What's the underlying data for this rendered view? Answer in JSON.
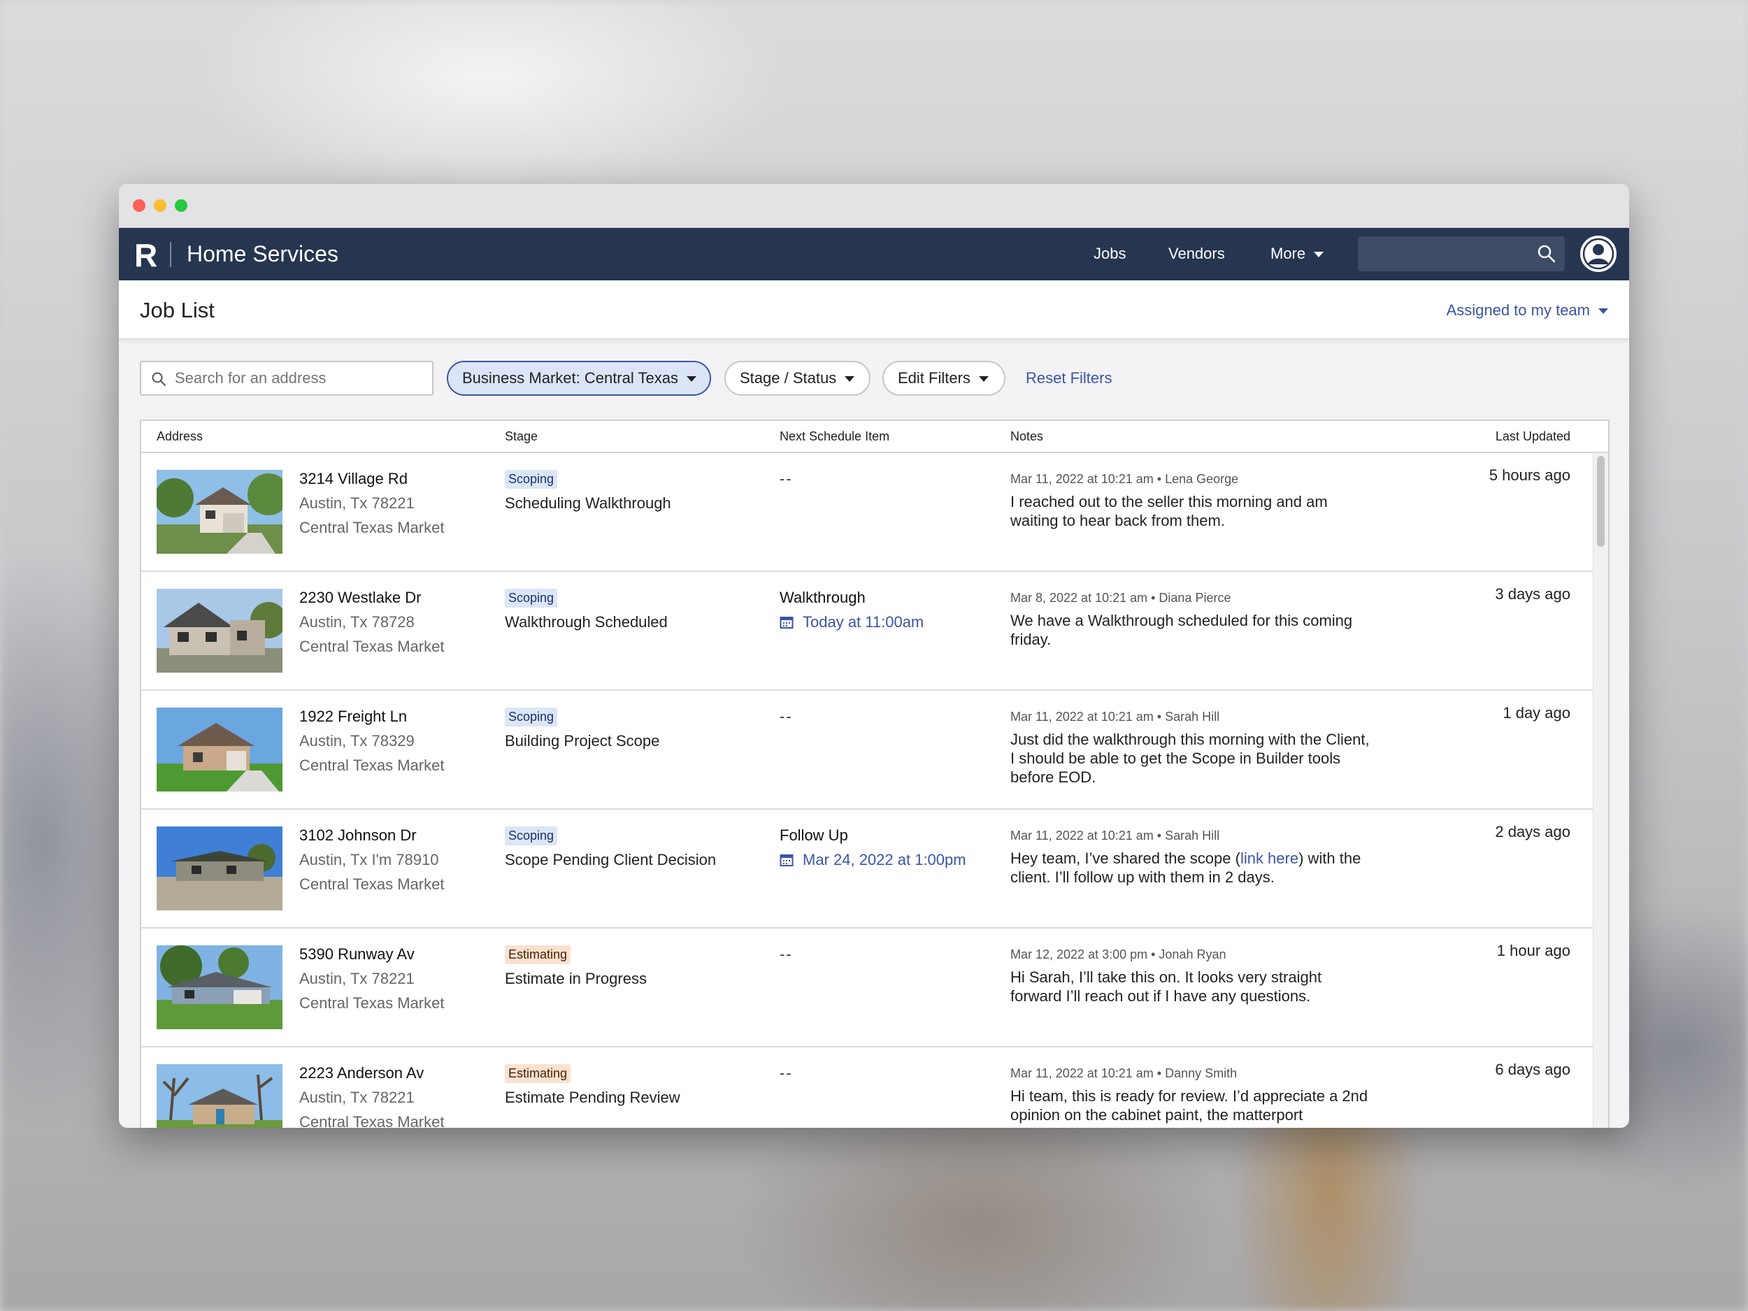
{
  "app": {
    "logo": "R",
    "brand": "Home Services"
  },
  "nav": {
    "jobs": "Jobs",
    "vendors": "Vendors",
    "more": "More",
    "search_value": ""
  },
  "page": {
    "title": "Job List",
    "assigned_filter": "Assigned to my team"
  },
  "filters": {
    "search_placeholder": "Search for an address",
    "market": "Business Market: Central Texas",
    "stage_status": "Stage / Status",
    "edit": "Edit Filters",
    "reset": "Reset Filters"
  },
  "table": {
    "headers": {
      "address": "Address",
      "stage": "Stage",
      "next": "Next Schedule Item",
      "notes": "Notes",
      "updated": "Last Updated"
    },
    "rows": [
      {
        "street": "3214 Village Rd",
        "city": "Austin, Tx 78221",
        "market": "Central Texas Market",
        "badge": "Scoping",
        "stage": "Scheduling Walkthrough",
        "next_title": "--",
        "next_date": "",
        "note_meta": "Mar 11, 2022 at 10:21 am • Lena George",
        "note": "I reached out to the seller this morning and am waiting to hear back from them.",
        "updated": "5 hours ago"
      },
      {
        "street": "2230 Westlake Dr",
        "city": "Austin, Tx 78728",
        "market": "Central Texas Market",
        "badge": "Scoping",
        "stage": "Walkthrough Scheduled",
        "next_title": "Walkthrough",
        "next_date": "Today at 11:00am",
        "note_meta": "Mar 8, 2022 at 10:21 am • Diana Pierce",
        "note": "We have a Walkthrough scheduled for this coming friday.",
        "updated": "3 days ago"
      },
      {
        "street": "1922 Freight Ln",
        "city": "Austin, Tx 78329",
        "market": "Central Texas Market",
        "badge": "Scoping",
        "stage": "Building Project Scope",
        "next_title": "--",
        "next_date": "",
        "note_meta": "Mar 11, 2022 at 10:21 am • Sarah Hill",
        "note": "Just did the walkthrough this morning with the Client, I should be able to get the Scope in Builder tools before EOD.",
        "updated": "1 day ago"
      },
      {
        "street": "3102 Johnson Dr",
        "city": "Austin, Tx I'm 78910",
        "market": "Central Texas Market",
        "badge": "Scoping",
        "stage": "Scope Pending Client Decision",
        "next_title": "Follow Up",
        "next_date": "Mar 24, 2022 at 1:00pm",
        "note_meta": "Mar 11, 2022 at 10:21 am • Sarah Hill",
        "note_pre": "Hey team, I’ve shared the scope (",
        "note_link": "link here",
        "note_post": ") with the client. I’ll follow up with them in 2 days.",
        "updated": "2 days ago"
      },
      {
        "street": "5390 Runway Av",
        "city": "Austin, Tx 78221",
        "market": "Central Texas Market",
        "badge": "Estimating",
        "stage": "Estimate in Progress",
        "next_title": "--",
        "next_date": "",
        "note_meta": "Mar 12, 2022 at 3:00 pm • Jonah Ryan",
        "note": "Hi Sarah, I’ll take this on. It looks very straight forward I’ll reach out if I have any questions.",
        "updated": "1 hour ago"
      },
      {
        "street": "2223 Anderson Av",
        "city": "Austin, Tx 78221",
        "market": "Central Texas Market",
        "badge": "Estimating",
        "stage": "Estimate Pending Review",
        "next_title": "--",
        "next_date": "",
        "note_meta": "Mar 11, 2022 at 10:21 am • Danny Smith",
        "note": "Hi team, this is ready for review. I’d appreciate a 2nd opinion on the cabinet paint, the matterport",
        "updated": "6 days ago"
      }
    ]
  },
  "colors": {
    "navbar": "#263550",
    "accent": "#3a55a4",
    "scoping_badge": "#dbe6f6",
    "estimating_badge": "#fbe1cf"
  },
  "icons": {
    "nav_search": "search-icon",
    "avatar": "user-avatar-icon",
    "calendar": "calendar-icon",
    "caret": "chevron-down-icon"
  }
}
